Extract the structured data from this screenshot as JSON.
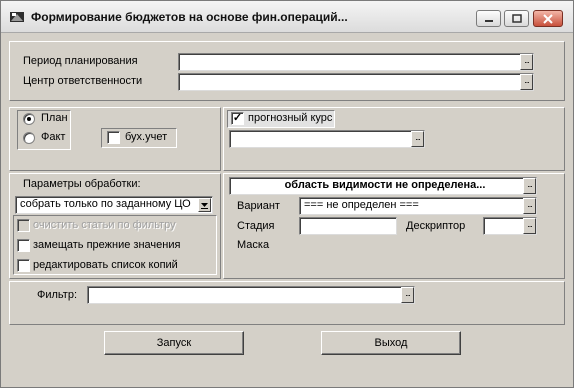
{
  "window": {
    "title": "Формирование бюджетов на основе фин.операций..."
  },
  "period": {
    "label": "Период планирования",
    "value": ""
  },
  "center": {
    "label": "Центр ответственности",
    "value": ""
  },
  "mode": {
    "options": [
      "План",
      "Факт"
    ],
    "selected": "План",
    "accounting_label": "бух.учет",
    "accounting_checked": false
  },
  "forecast": {
    "label": "прогнозный курс",
    "checked": true,
    "value": ""
  },
  "processing": {
    "label": "Параметры обработки:",
    "select_value": "собрать только по заданному ЦО",
    "options": [
      {
        "label": "очистить статьи по фильтру",
        "checked": false,
        "disabled": true
      },
      {
        "label": "замещать прежние значения",
        "checked": false,
        "disabled": false
      },
      {
        "label": "редактировать список копий",
        "checked": false,
        "disabled": false
      }
    ]
  },
  "scope": {
    "header": "область видимости не определена...",
    "variant_label": "Вариант",
    "variant_value": "=== не определен ===",
    "stage_label": "Стадия",
    "stage_value": "",
    "descriptor_label": "Дескриптор",
    "descriptor_value": "",
    "mask_label": "Маска"
  },
  "filter": {
    "label": "Фильтр:",
    "value": ""
  },
  "buttons": {
    "run": "Запуск",
    "exit": "Выход"
  },
  "ellipsis": "..."
}
